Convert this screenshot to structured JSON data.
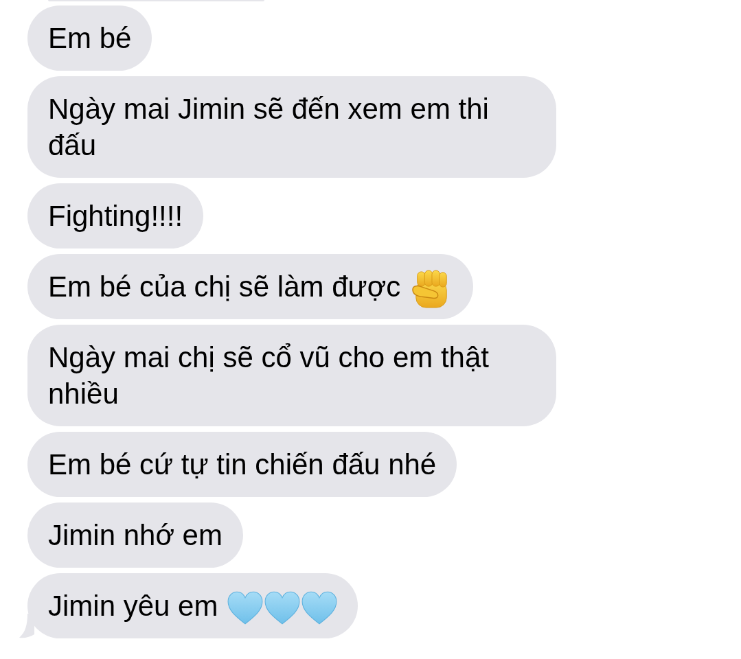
{
  "messages": [
    {
      "text": "Em bé",
      "tail": false
    },
    {
      "text": "Ngày mai Jimin sẽ đến xem em thi đấu",
      "tail": false
    },
    {
      "text": "Fighting!!!!",
      "tail": false
    },
    {
      "text": "Em bé của chị sẽ làm được",
      "icons": [
        {
          "kind": "fist"
        }
      ],
      "tail": false
    },
    {
      "text": "Ngày mai chị sẽ cổ vũ cho em thật nhiều",
      "tail": false
    },
    {
      "text": "Em bé cứ tự tin chiến đấu nhé",
      "tail": false
    },
    {
      "text": "Jimin nhớ em",
      "tail": false
    },
    {
      "text": "Jimin yêu em",
      "icons": [
        {
          "kind": "heart"
        },
        {
          "kind": "heart"
        },
        {
          "kind": "heart"
        }
      ],
      "tail": true
    }
  ]
}
